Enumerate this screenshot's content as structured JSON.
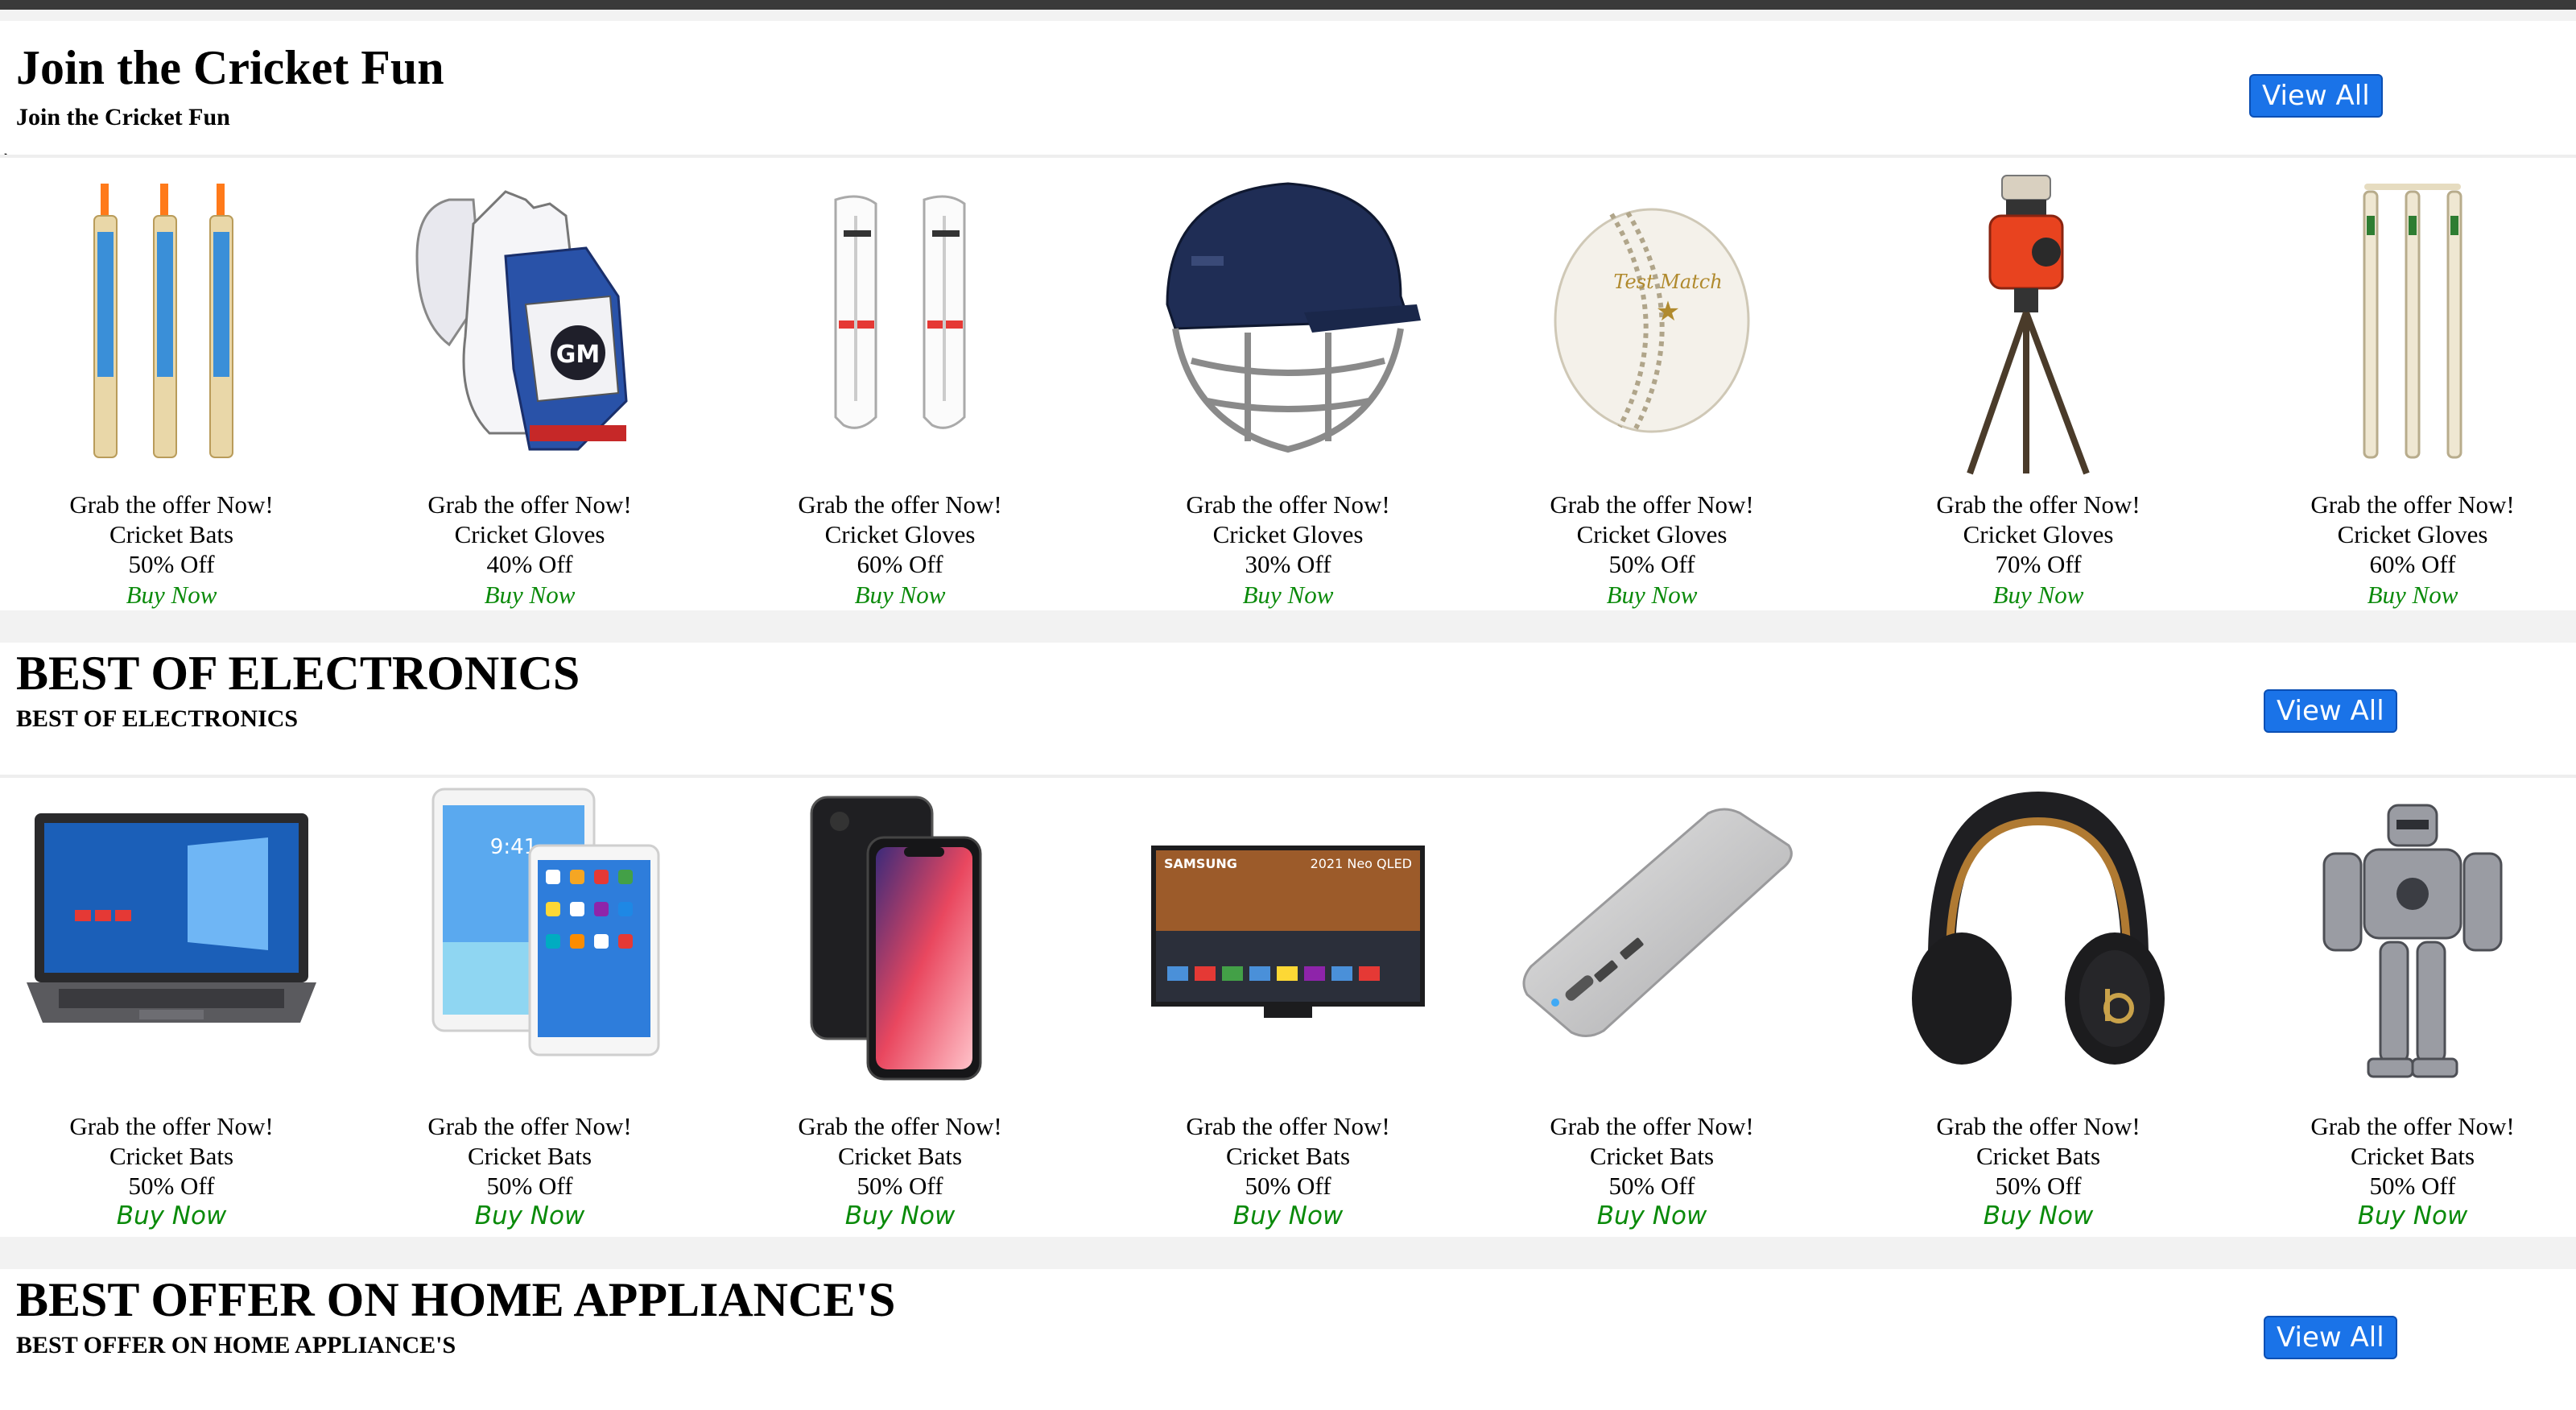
{
  "sections": [
    {
      "title": "Join the Cricket Fun",
      "subtitle": "Join the Cricket Fun",
      "view_all": "View All",
      "stray_mark": "`",
      "products": [
        {
          "tagline": "Grab the offer Now!",
          "name": "Cricket Bats",
          "discount": "50% Off",
          "cta": "Buy Now",
          "icon": "cricket-bats-icon"
        },
        {
          "tagline": "Grab the offer Now!",
          "name": "Cricket Gloves",
          "discount": "40% Off",
          "cta": "Buy Now",
          "icon": "cricket-gloves-icon"
        },
        {
          "tagline": "Grab the offer Now!",
          "name": "Cricket Gloves",
          "discount": "60% Off",
          "cta": "Buy Now",
          "icon": "batting-pads-icon"
        },
        {
          "tagline": "Grab the offer Now!",
          "name": "Cricket Gloves",
          "discount": "30% Off",
          "cta": "Buy Now",
          "icon": "cricket-helmet-icon"
        },
        {
          "tagline": "Grab the offer Now!",
          "name": "Cricket Gloves",
          "discount": "50% Off",
          "cta": "Buy Now",
          "icon": "cricket-ball-icon"
        },
        {
          "tagline": "Grab the offer Now!",
          "name": "Cricket Gloves",
          "discount": "70% Off",
          "cta": "Buy Now",
          "icon": "bowling-machine-icon"
        },
        {
          "tagline": "Grab the offer Now!",
          "name": "Cricket Gloves",
          "discount": "60% Off",
          "cta": "Buy Now",
          "icon": "cricket-stumps-icon"
        }
      ]
    },
    {
      "title": "BEST OF ELECTRONICS",
      "subtitle": "BEST OF ELECTRONICS",
      "view_all": "View All",
      "products": [
        {
          "tagline": "Grab the offer Now!",
          "name": "Cricket Bats",
          "discount": "50% Off",
          "cta": "Buy Now",
          "icon": "laptop-icon"
        },
        {
          "tagline": "Grab the offer Now!",
          "name": "Cricket Bats",
          "discount": "50% Off",
          "cta": "Buy Now",
          "icon": "tablet-icon"
        },
        {
          "tagline": "Grab the offer Now!",
          "name": "Cricket Bats",
          "discount": "50% Off",
          "cta": "Buy Now",
          "icon": "smartphone-icon"
        },
        {
          "tagline": "Grab the offer Now!",
          "name": "Cricket Bats",
          "discount": "50% Off",
          "cta": "Buy Now",
          "icon": "television-icon"
        },
        {
          "tagline": "Grab the offer Now!",
          "name": "Cricket Bats",
          "discount": "50% Off",
          "cta": "Buy Now",
          "icon": "power-bank-icon"
        },
        {
          "tagline": "Grab the offer Now!",
          "name": "Cricket Bats",
          "discount": "50% Off",
          "cta": "Buy Now",
          "icon": "headphones-icon"
        },
        {
          "tagline": "Grab the offer Now!",
          "name": "Cricket Bats",
          "discount": "50% Off",
          "cta": "Buy Now",
          "icon": "robot-toy-icon"
        }
      ]
    },
    {
      "title": "BEST OFFER ON HOME APPLIANCE'S",
      "subtitle": "BEST OFFER ON HOME APPLIANCE'S",
      "view_all": "View All"
    }
  ],
  "product_image_text": {
    "tv_brand": "SAMSUNG",
    "tv_model": "2021 Neo QLED",
    "gloves_brand": "GM",
    "ball_label": "Test Match",
    "tablet_time": "9:41"
  },
  "colors": {
    "view_all_bg": "#1a73e8",
    "buy_now": "#0a8a0a",
    "page_gap": "#f2f2f2"
  }
}
